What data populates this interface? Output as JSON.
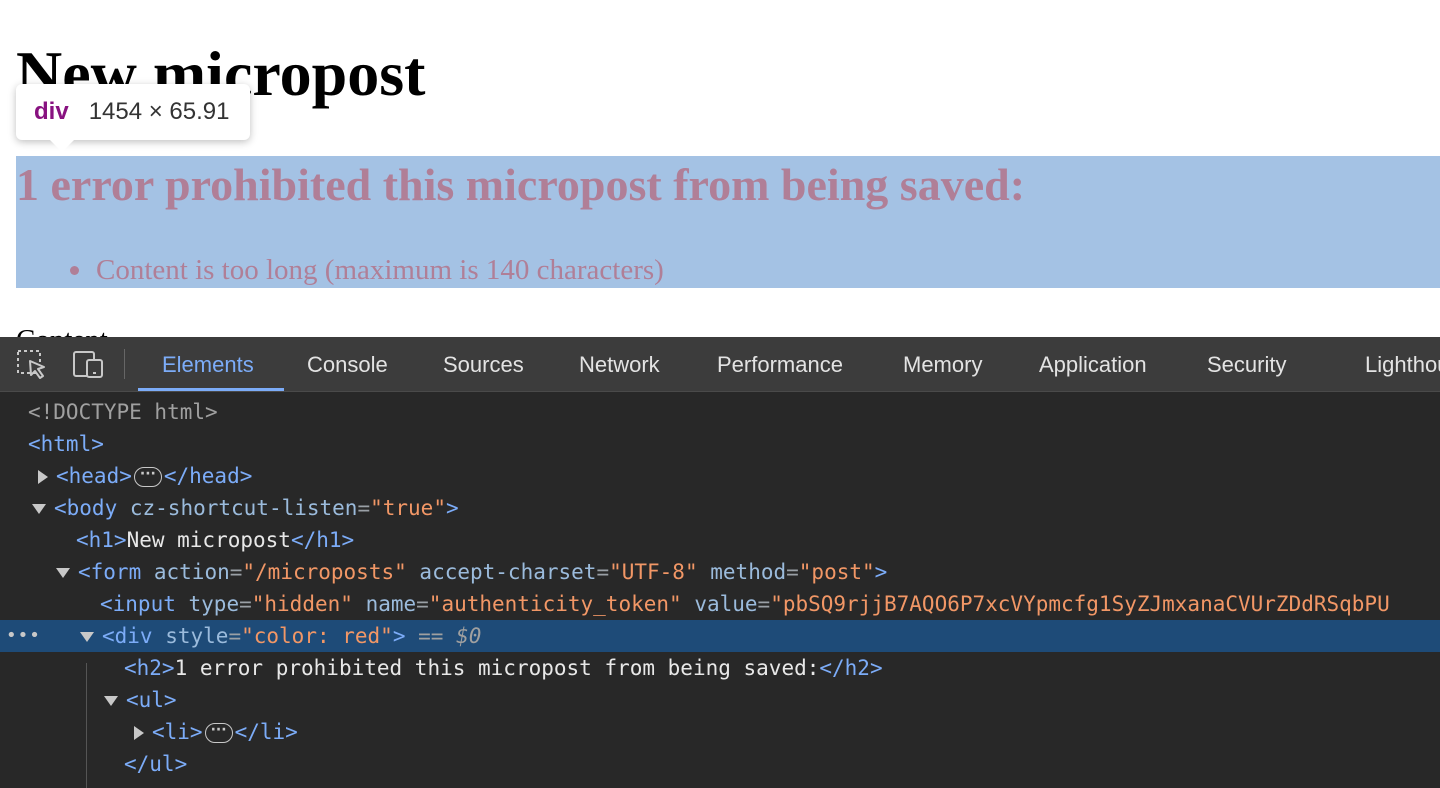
{
  "page": {
    "title": "New micropost",
    "error_heading": "1 error prohibited this micropost from being saved:",
    "error_item": "Content is too long (maximum is 140 characters)",
    "content_label": "Content"
  },
  "tooltip": {
    "tag": "div",
    "size": "1454 × 65.91"
  },
  "devtools": {
    "tabs": [
      {
        "label": "Elements",
        "active": true
      },
      {
        "label": "Console"
      },
      {
        "label": "Sources"
      },
      {
        "label": "Network"
      },
      {
        "label": "Performance"
      },
      {
        "label": "Memory"
      },
      {
        "label": "Application"
      },
      {
        "label": "Security"
      },
      {
        "label": "Lighthouse"
      }
    ],
    "icons": {
      "inspect": "inspect-element-icon",
      "device": "device-toolbar-icon"
    },
    "accent_color": "#7cacf8",
    "selection_color": "#1e4b78",
    "dom": {
      "doctype": "<!DOCTYPE html>",
      "html_open": "<html>",
      "head_open": "<head>",
      "head_close": "</head>",
      "body_open": "<body",
      "body_attr_name": "cz-shortcut-listen",
      "body_attr_value": "\"true\"",
      "tag_close": ">",
      "h1_open": "<h1>",
      "h1_text": "New micropost",
      "h1_close": "</h1>",
      "form_open": "<form",
      "form_attr1_name": "action",
      "form_attr1_value": "\"/microposts\"",
      "form_attr2_name": "accept-charset",
      "form_attr2_value": "\"UTF-8\"",
      "form_attr3_name": "method",
      "form_attr3_value": "\"post\"",
      "input_open": "<input",
      "input_attr1_name": "type",
      "input_attr1_value": "\"hidden\"",
      "input_attr2_name": "name",
      "input_attr2_value": "\"authenticity_token\"",
      "input_attr3_name": "value",
      "input_attr3_value": "\"pbSQ9rjjB7AQO6P7xcVYpmcfg1SyZJmxanaCVUrZDdRSqbPU",
      "div_open": "<div",
      "div_attr_name": "style",
      "div_attr_value": "\"color: red\"",
      "selected_marker": "== ",
      "selected_var": "$0",
      "h2_open": "<h2>",
      "h2_text": "1 error prohibited this micropost from being saved:",
      "h2_close": "</h2>",
      "ul_open": "<ul>",
      "li_open": "<li>",
      "li_close": "</li>",
      "ul_close": "</ul>",
      "gutter_dots": "•••"
    }
  }
}
